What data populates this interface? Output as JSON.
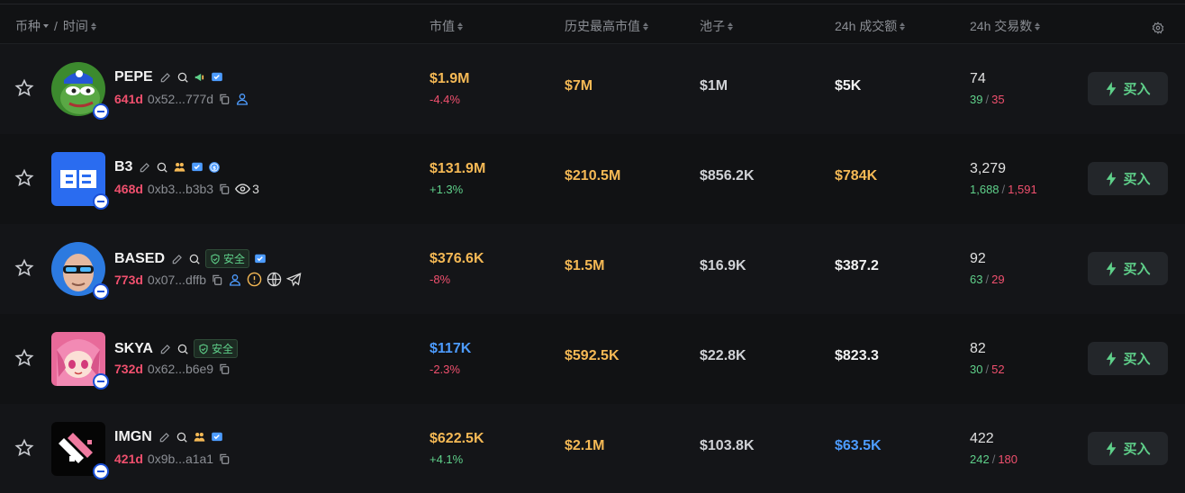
{
  "header": {
    "coin_label": "币种",
    "time_label": "时间",
    "slash": "/",
    "mcap_label": "市值",
    "ath_label": "历史最高市值",
    "pool_label": "池子",
    "vol_label": "24h 成交额",
    "txns_label": "24h 交易数"
  },
  "colors": {
    "gold": "#f5b955",
    "blue": "#4d9cff",
    "white": "#f2f2f2",
    "gray": "#d0d2d6",
    "green": "#5fd08a",
    "red": "#f0506e"
  },
  "rows": [
    {
      "symbol": "PEPE",
      "age": "641d",
      "address": "0x52...777d",
      "safe_label": "",
      "holders": "",
      "market_cap": "$1.9M",
      "change": "-4.4%",
      "ath": "$7M",
      "pool": "$1M",
      "volume": "$5K",
      "txns": "74",
      "buys": "39",
      "sells": "35",
      "buy_label": "买入"
    },
    {
      "symbol": "B3",
      "age": "468d",
      "address": "0xb3...b3b3",
      "safe_label": "",
      "holders": "3",
      "market_cap": "$131.9M",
      "change": "+1.3%",
      "ath": "$210.5M",
      "pool": "$856.2K",
      "volume": "$784K",
      "txns": "3,279",
      "buys": "1,688",
      "sells": "1,591",
      "buy_label": "买入"
    },
    {
      "symbol": "BASED",
      "age": "773d",
      "address": "0x07...dffb",
      "safe_label": "安全",
      "holders": "",
      "market_cap": "$376.6K",
      "change": "-8%",
      "ath": "$1.5M",
      "pool": "$16.9K",
      "volume": "$387.2",
      "txns": "92",
      "buys": "63",
      "sells": "29",
      "buy_label": "买入"
    },
    {
      "symbol": "SKYA",
      "age": "732d",
      "address": "0x62...b6e9",
      "safe_label": "安全",
      "holders": "",
      "market_cap": "$117K",
      "change": "-2.3%",
      "ath": "$592.5K",
      "pool": "$22.8K",
      "volume": "$823.3",
      "txns": "82",
      "buys": "30",
      "sells": "52",
      "buy_label": "买入"
    },
    {
      "symbol": "IMGN",
      "age": "421d",
      "address": "0x9b...a1a1",
      "safe_label": "",
      "holders": "",
      "market_cap": "$622.5K",
      "change": "+4.1%",
      "ath": "$2.1M",
      "pool": "$103.8K",
      "volume": "$63.5K",
      "txns": "422",
      "buys": "242",
      "sells": "180",
      "buy_label": "买入"
    }
  ]
}
